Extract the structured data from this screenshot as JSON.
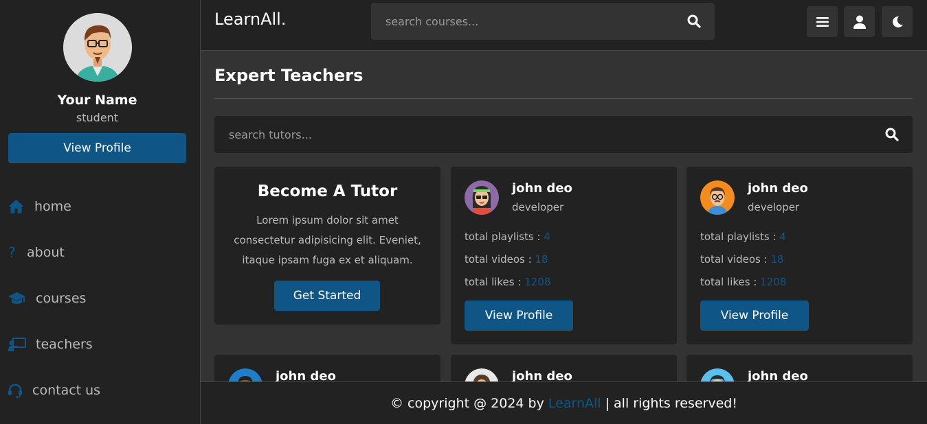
{
  "sidebar": {
    "profile_name": "Your Name",
    "profile_role": "student",
    "view_profile_label": "View Profile",
    "nav": [
      {
        "label": "home",
        "icon": "home-icon"
      },
      {
        "label": "about",
        "icon": "question-icon"
      },
      {
        "label": "courses",
        "icon": "graduation-cap-icon"
      },
      {
        "label": "teachers",
        "icon": "chalkboard-teacher-icon"
      },
      {
        "label": "contact us",
        "icon": "headset-icon"
      }
    ]
  },
  "header": {
    "logo": "LearnAll.",
    "search_placeholder": "search courses...",
    "buttons": [
      "menu-icon",
      "user-icon",
      "moon-icon"
    ]
  },
  "main": {
    "title": "Expert Teachers",
    "search_placeholder": "search tutors...",
    "become_tutor": {
      "title": "Become A Tutor",
      "text": "Lorem ipsum dolor sit amet consectetur adipisicing elit. Eveniet, itaque ipsam fuga ex et aliquam.",
      "button": "Get Started"
    },
    "tutors": [
      {
        "name": "john deo",
        "role": "developer",
        "playlists_label": "total playlists : ",
        "playlists": "4",
        "videos_label": "total videos : ",
        "videos": "18",
        "likes_label": "total likes : ",
        "likes": "1208",
        "button": "View Profile"
      },
      {
        "name": "john deo",
        "role": "developer",
        "playlists_label": "total playlists : ",
        "playlists": "4",
        "videos_label": "total videos : ",
        "videos": "18",
        "likes_label": "total likes : ",
        "likes": "1208",
        "button": "View Profile"
      },
      {
        "name": "john deo"
      },
      {
        "name": "john deo"
      },
      {
        "name": "john deo"
      }
    ]
  },
  "footer": {
    "prefix": "© copyright @ 2024 by ",
    "brand": "LearnAll",
    "suffix": " | all rights reserved!"
  },
  "colors": {
    "accent": "#0f5687",
    "background": "#333333",
    "panel": "#222222"
  }
}
